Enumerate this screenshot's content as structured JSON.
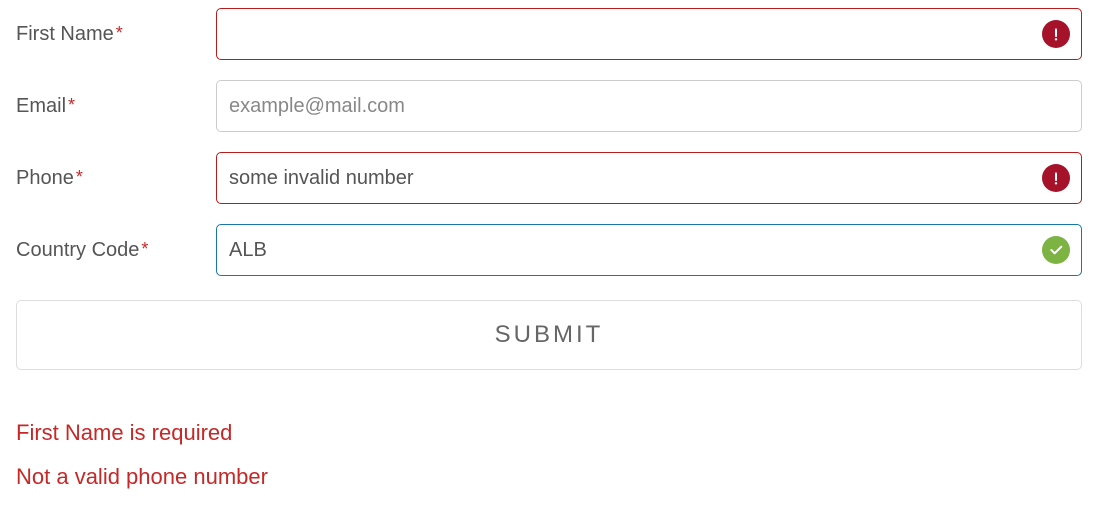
{
  "fields": {
    "firstName": {
      "label": "First Name",
      "value": "",
      "placeholder": ""
    },
    "email": {
      "label": "Email",
      "value": "",
      "placeholder": "example@mail.com"
    },
    "phone": {
      "label": "Phone",
      "value": "some invalid number",
      "placeholder": ""
    },
    "countryCode": {
      "label": "Country Code",
      "value": "ALB",
      "placeholder": ""
    }
  },
  "requiredMark": "*",
  "submit": {
    "label": "SUBMIT"
  },
  "errors": {
    "firstNameRequired": "First Name is required",
    "phoneInvalid": "Not a valid phone number"
  }
}
